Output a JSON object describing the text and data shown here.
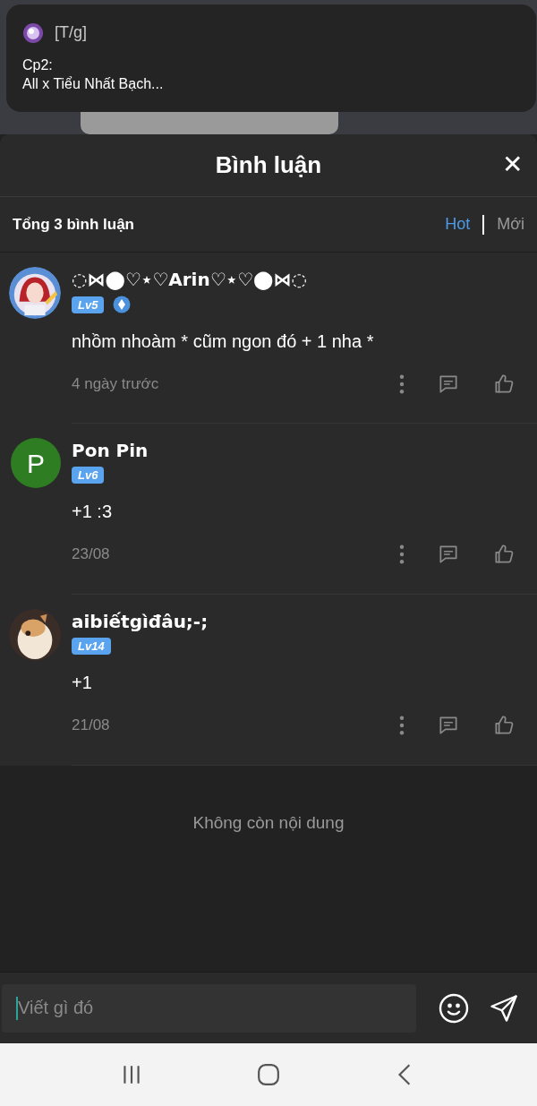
{
  "notification": {
    "sender": "[T/g]",
    "lines": [
      "Cp2:",
      "All x Tiểu Nhất Bạch..."
    ]
  },
  "sheet": {
    "title": "Bình luận",
    "close": "✕"
  },
  "toolbar": {
    "total": "Tổng 3 bình luận",
    "sort_tabs": [
      {
        "label": "Hot",
        "selected": true
      },
      {
        "label": "Mới",
        "selected": false
      }
    ]
  },
  "comments": [
    {
      "name": "◌⋈⬤♡⋆♡Arin♡⋆♡⬤⋈◌",
      "level": "Lv5",
      "writer_badge": true,
      "text": "nhồm nhoàm * cũm ngon đó + 1 nha *",
      "time": "4 ngày trước"
    },
    {
      "avatar": {
        "kind": "letter",
        "letter": "P",
        "color": "#2e7d22"
      },
      "name": "Pon Pin",
      "level": "Lv6",
      "writer_badge": false,
      "text": "+1 :3",
      "time": "23/08"
    },
    {
      "name": "aibiếtgìđâu;-;",
      "level": "Lv14",
      "writer_badge": false,
      "text": "+1",
      "time": "21/08"
    }
  ],
  "end_message": "Không còn nội dung",
  "composer": {
    "placeholder": "Viết gì đó"
  }
}
